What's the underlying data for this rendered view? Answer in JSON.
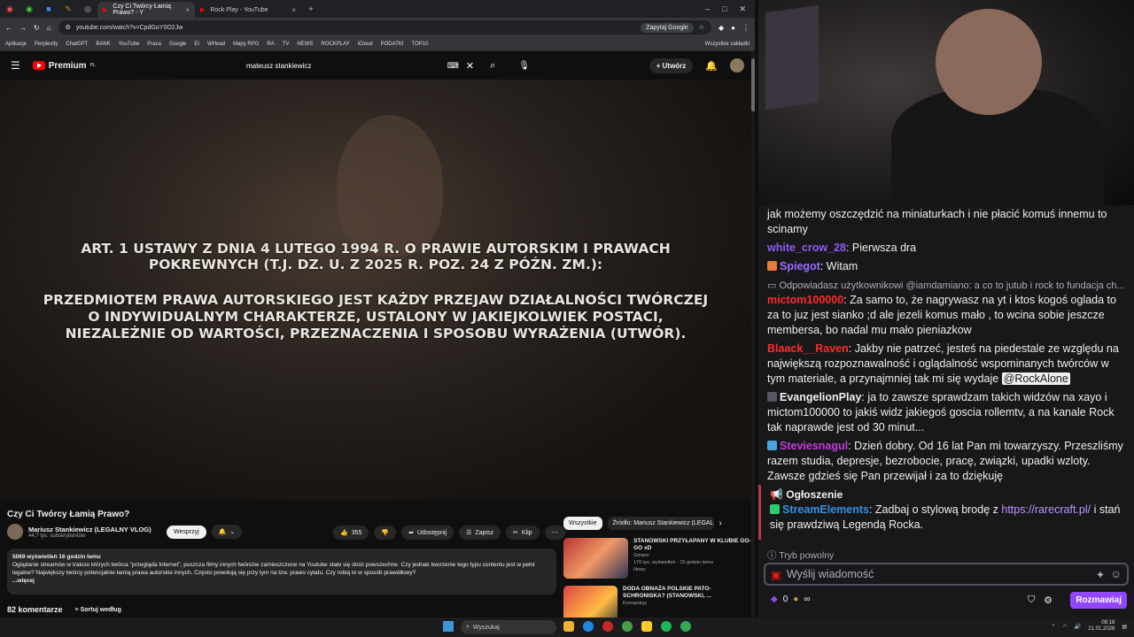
{
  "browser": {
    "tabs": [
      {
        "title": "Czy Ci Twórcy Łamią Prawo? - Y",
        "active": true
      },
      {
        "title": "Rock Play - YouTube",
        "active": false
      }
    ],
    "url": "youtube.com/watch?v=CpdGoY0O2Jw",
    "google_button": "Zapytaj Google",
    "bookmarks": [
      "Aplikacje",
      "Perplexity",
      "ChatGPT",
      "BANK",
      "YouTube",
      "Praca",
      "Google",
      "EI",
      "WHead",
      "Mapy RPG",
      "RA",
      "TV",
      "NEWS",
      "ROCKPLAY",
      "iCloud",
      "PODATKI",
      "TOP10"
    ],
    "bookmarks_right": "Wszystkie zakładki"
  },
  "youtube": {
    "logo": "Premium",
    "logo_sup": "PL",
    "search_query": "mateusz stankiewicz",
    "create_label": "Utwórz",
    "video_overlay": {
      "line1": "ART.  1 USTAWY Z DNIA 4 LUTEGO 1994 R. O PRAWIE AUTORSKIM I PRAWACH",
      "line2": "POKREWNYCH (T.J. DZ. U. Z 2025 R. POZ. 24 Z PÓŹN. ZM.):",
      "line3": "PRZEDMIOTEM PRAWA AUTORSKIEGO JEST KAŻDY PRZEJAW DZIAŁALNOŚCI TWÓRCZEJ",
      "line4": "O INDYWIDUALNYM CHARAKTERZE, USTALONY W JAKIEJKOLWIEK POSTACI,",
      "line5": "NIEZALEŻNIE OD WARTOŚCI, PRZEZNACZENIA I SPOSOBU WYRAŻENIA (UTWÓR)."
    },
    "video_title": "Czy Ci Twórcy Łamią Prawo?",
    "channel_name": "Mariusz Stankiewicz (LEGALNY VLOG)",
    "channel_subs": "44,7 tys. subskrybentów",
    "support_label": "Wesprzyj",
    "likes": "355",
    "share_label": "Udostępnij",
    "save_label": "Zapisz",
    "clip_label": "Klip",
    "description": {
      "stats": "5069 wyświetleń  16 godzin temu",
      "text": "Oglądanie streamów w trakcie których twórca \"przegląda Internet\", puszcza filmy innych twórców zamieszczone na Youtube stało się dość powszechne. Czy jednak tworzenie tego typu contentu jest w pełni legalne? Największy twórcy potencjalnie łamią prawa autorskie innych. Często powołują się przy tym na tzw. prawo cytatu. Czy robią to w sposób prawidłowy?",
      "more": "...więcej"
    },
    "comments_count": "82 komentarze",
    "sort_label": "Sortuj według",
    "chips": [
      "Wszystkie",
      "Źródło: Mariusz Stankiewicz (LEGALN"
    ],
    "recommendations": [
      {
        "title": "STANOWSKI PRZYŁAPANY W KLUBIE GO-GO xD",
        "channel": "Gimper",
        "meta": "170 tys. wyświetleń · 15 godzin temu",
        "badge": "Nowy"
      },
      {
        "title": "DODA OBNAŻA POLSKIE PATO-SCHRONISKA? (STANOWSKI, ...",
        "channel": "Konopskyy",
        "meta": "",
        "badge": ""
      }
    ]
  },
  "chat": {
    "messages": [
      {
        "user": "",
        "color": "#efeff1",
        "text": "jak możemy oszczędzić na miniaturkach i nie płacić komuś innemu to scinamy"
      },
      {
        "user": "white_crow_28",
        "color": "#8a5cf6",
        "text": "Pierwsza dra"
      },
      {
        "user": "Spiegot",
        "color": "#9b6cff",
        "text": "Witam"
      },
      {
        "reply": "Odpowiadasz użytkownikowi @iamdamiano: a co to jutub i rock to fundacja ch..."
      },
      {
        "user": "mictom100000",
        "color": "#ff2a2a",
        "text": "Za samo to, że nagrywasz na yt i ktos kogoś oglada to za to juz jest sianko ;d ale jezeli komus mało , to wcina sobie jeszcze membersa, bo nadal mu mało pieniazkow"
      },
      {
        "user": "Blaack__Raven",
        "color": "#ff2a2a",
        "text": "Jakby nie patrzeć, jesteś na piedestale ze względu na największą rozpoznawalność i oglądalność wspominanych twórców w tym materiale, a przynajmniej tak mi się wydaje",
        "mention": "@RockAlone"
      },
      {
        "user": "EvangelionPlay",
        "color": "#efeff1",
        "text": "ja to zawsze sprawdzam takich widzów na xayo i mictom100000 to jakiś widz jakiegoś goscia rollemtv, a na kanale Rock tak naprawde jest od 30 minut..."
      },
      {
        "user": "Steviesnagul",
        "color": "#c13ed6",
        "text": "Dzień dobry. Od 16 lat Pan mi towarzyszy. Przeszliśmy razem studia, depresje, bezrobocie, pracę, związki, upadki wzloty. Zawsze gdzieś się Pan przewijał i za to dziękuję"
      }
    ],
    "announcement": {
      "header": "Ogłoszenie",
      "user": "StreamElements",
      "text": "Zadbaj o stylową brodę z",
      "link": "https://rarecraft.pl/",
      "text2": "i stań się prawdziwą Legendą Rocka."
    },
    "mode_label": "Tryb powolny",
    "input_placeholder": "Wyślij wiadomość",
    "points": "0",
    "send_label": "Rozmawiaj"
  },
  "taskbar": {
    "search_label": "Wyszukaj",
    "time": "08:18",
    "date": "21.01.2026"
  },
  "colors": {
    "yt_red": "#ff0000",
    "twitch_purple": "#9147ff",
    "chat_bg": "#18181b"
  }
}
